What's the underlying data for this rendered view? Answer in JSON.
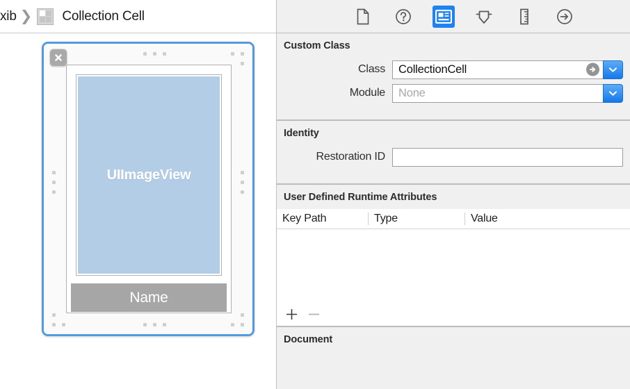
{
  "breadcrumb": {
    "leading_text": "xib",
    "separator": "❯",
    "icon": "collection-view-icon",
    "current": "Collection Cell"
  },
  "canvas": {
    "close_badge_icon": "close-x-icon",
    "image_view_label": "UIImageView",
    "name_label": "Name",
    "selection_color": "#549ade",
    "image_view_color": "#b4cde6",
    "name_label_color": "#a6a6a6",
    "handle_dot_color": "#cfcfcf"
  },
  "inspector": {
    "tabs": [
      {
        "name": "file-inspector",
        "icon": "document-icon",
        "selected": false
      },
      {
        "name": "quick-help-inspector",
        "icon": "question-mark-icon",
        "selected": false
      },
      {
        "name": "identity-inspector",
        "icon": "identity-card-icon",
        "selected": true
      },
      {
        "name": "attributes-inspector",
        "icon": "slider-arrow-icon",
        "selected": false
      },
      {
        "name": "size-inspector",
        "icon": "ruler-icon",
        "selected": false
      },
      {
        "name": "connections-inspector",
        "icon": "arrow-circle-icon",
        "selected": false
      }
    ],
    "selected_tab_color": "#1e82f0",
    "custom_class": {
      "header": "Custom Class",
      "class_label": "Class",
      "class_value": "CollectionCell",
      "class_nav_icon": "jump-to-definition-arrow-icon",
      "module_label": "Module",
      "module_value": "",
      "module_placeholder": "None",
      "dropdown_icon": "chevron-down-icon"
    },
    "identity": {
      "header": "Identity",
      "restoration_id_label": "Restoration ID",
      "restoration_id_value": "",
      "restoration_id_placeholder": ""
    },
    "runtime_attributes": {
      "header": "User Defined Runtime Attributes",
      "columns": [
        "Key Path",
        "Type",
        "Value"
      ],
      "rows": [],
      "add_button_label": "+",
      "remove_button_label": "−",
      "remove_enabled": false
    },
    "document": {
      "header": "Document"
    }
  }
}
